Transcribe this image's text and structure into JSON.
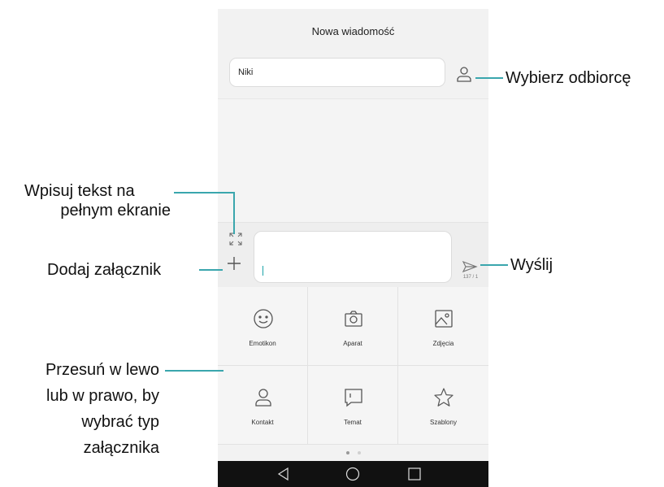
{
  "colors": {
    "accent": "#3aa6ad",
    "icon": "#555555",
    "nav_bg": "#111111",
    "dot_active": "#999999",
    "dot_inactive": "#d0d0d0"
  },
  "screen": {
    "title": "Nowa wiadomość",
    "recipient": {
      "value": "Niki",
      "icon": "person-icon"
    },
    "composer": {
      "expand_icon": "expand-icon",
      "add_icon": "plus-icon",
      "send_icon": "send-icon",
      "counter": "137 / 1"
    },
    "attachments": [
      {
        "label": "Emotikon",
        "icon": "smiley-icon"
      },
      {
        "label": "Aparat",
        "icon": "camera-icon"
      },
      {
        "label": "Zdjęcia",
        "icon": "image-icon"
      },
      {
        "label": "Kontakt",
        "icon": "person-icon"
      },
      {
        "label": "Temat",
        "icon": "message-square-icon"
      },
      {
        "label": "Szablony",
        "icon": "star-icon"
      }
    ],
    "pager": {
      "pages": 2,
      "active": 1
    },
    "navbar": [
      "back-icon",
      "home-icon",
      "recents-icon"
    ]
  },
  "callouts": {
    "recipient": "Wybierz odbiorcę",
    "fullscreen_line1": "Wpisuj tekst na",
    "fullscreen_line2": "pełnym ekranie",
    "attach": "Dodaj załącznik",
    "send": "Wyślij",
    "swipe_line1": "Przesuń w lewo",
    "swipe_line2": "lub w prawo, by",
    "swipe_line3": "wybrać typ",
    "swipe_line4": "załącznika"
  }
}
